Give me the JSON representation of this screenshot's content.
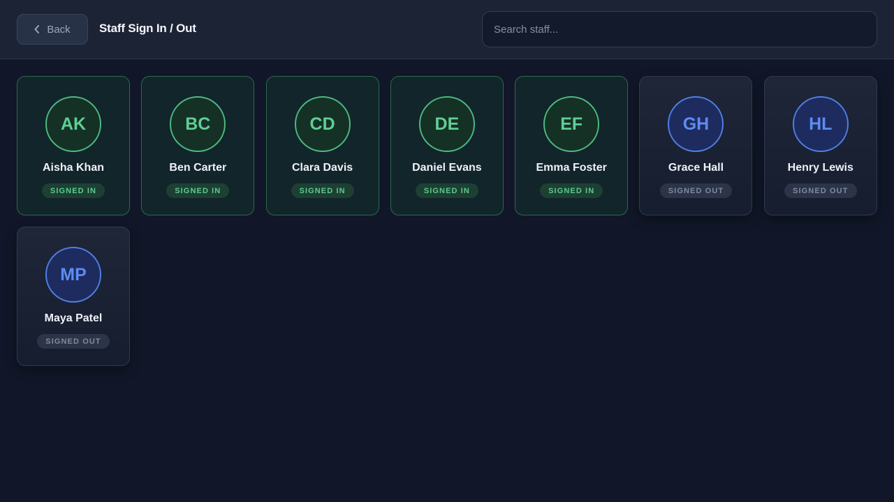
{
  "header": {
    "back_label": "Back",
    "title": "Staff Sign In / Out",
    "search_placeholder": "Search staff..."
  },
  "staff": [
    {
      "initials": "AK",
      "name": "Aisha Khan",
      "status": "SIGNED IN"
    },
    {
      "initials": "BC",
      "name": "Ben Carter",
      "status": "SIGNED IN"
    },
    {
      "initials": "CD",
      "name": "Clara Davis",
      "status": "SIGNED IN"
    },
    {
      "initials": "DE",
      "name": "Daniel Evans",
      "status": "SIGNED IN"
    },
    {
      "initials": "EF",
      "name": "Emma Foster",
      "status": "SIGNED IN"
    },
    {
      "initials": "GH",
      "name": "Grace Hall",
      "status": "SIGNED OUT"
    },
    {
      "initials": "HL",
      "name": "Henry Lewis",
      "status": "SIGNED OUT"
    },
    {
      "initials": "MP",
      "name": "Maya Patel",
      "status": "SIGNED OUT"
    }
  ],
  "colors": {
    "signed_in_accent": "#5fcf95",
    "signed_out_accent": "#5d8cf2",
    "background": "#111728"
  },
  "icons": {
    "back": "chevron-left-icon"
  }
}
